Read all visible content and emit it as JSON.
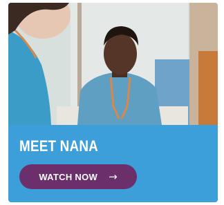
{
  "card": {
    "title": "MEET NANA",
    "button_label": "WATCH NOW",
    "button_icon": "arrow-right-icon",
    "arrow_glyph": "→",
    "colors": {
      "card_background": "#3d9fd9",
      "button_background": "#6b2f6b",
      "text": "#ffffff"
    }
  }
}
